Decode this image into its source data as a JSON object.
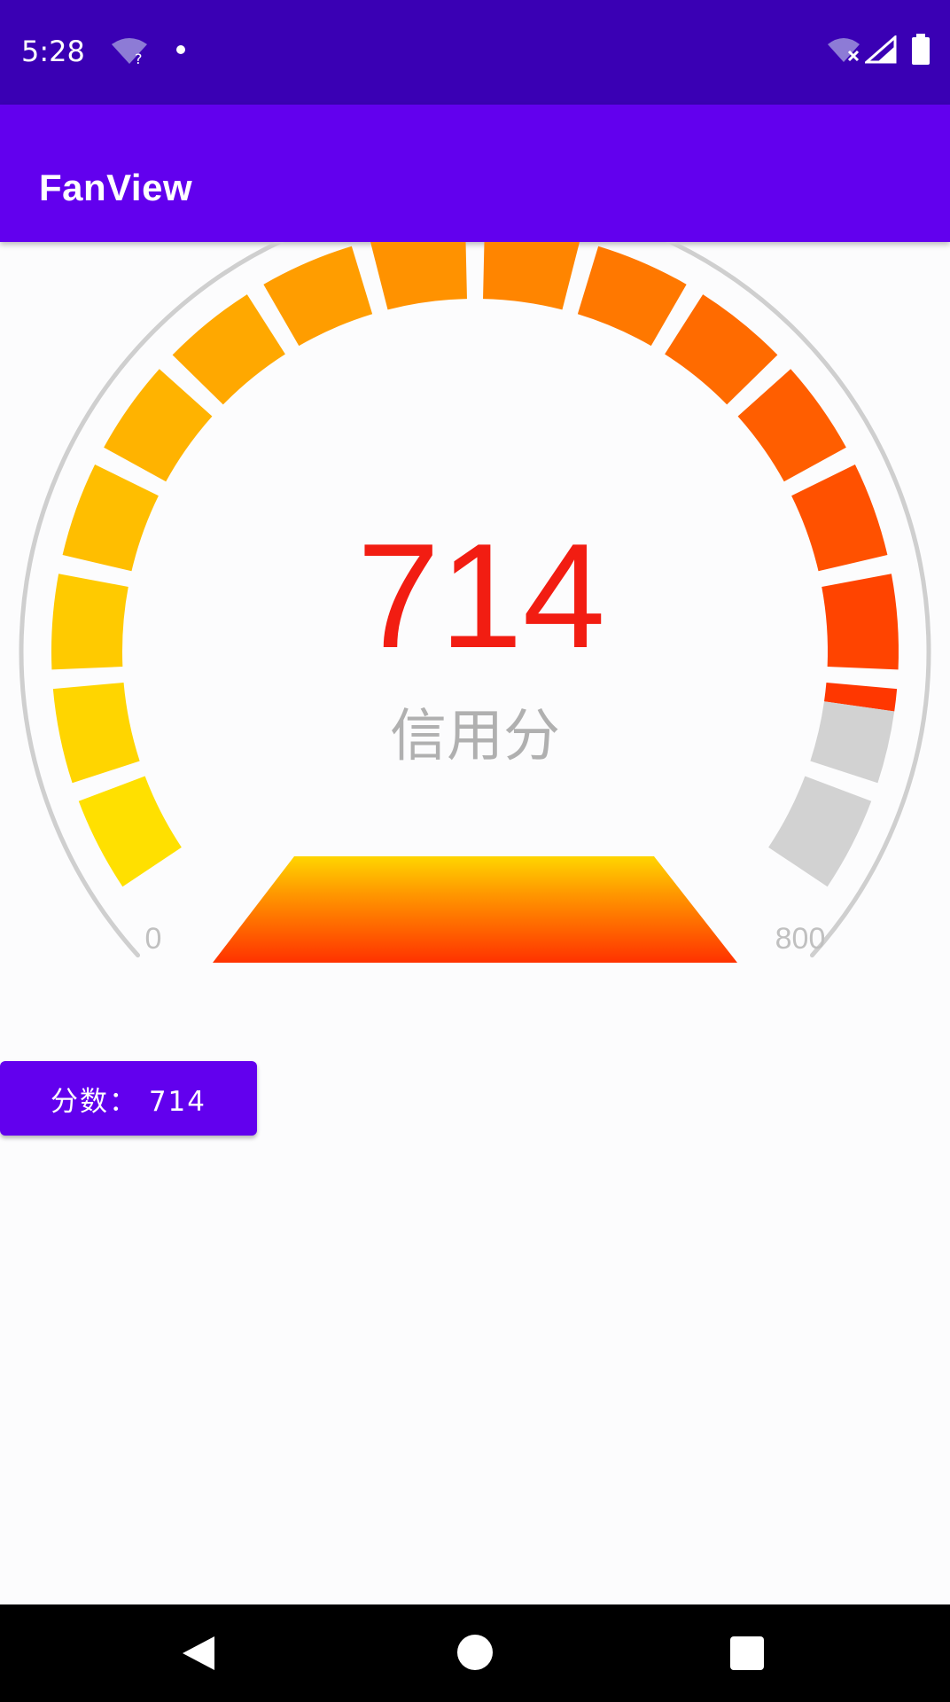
{
  "status_bar": {
    "time": "5:28",
    "wifi_badge": "?",
    "icons": [
      "wifi-question-icon",
      "notification-dot-icon",
      "wifi-off-icon",
      "signal-icon",
      "battery-icon"
    ]
  },
  "app_bar": {
    "title": "FanView"
  },
  "gauge": {
    "score": "714",
    "caption": "信用分",
    "min_label": "0",
    "max_label": "800",
    "value_fraction": 0.8925,
    "segment_count": 16,
    "colors": {
      "score_text": "#f21d12",
      "caption_text": "#b0b0b0",
      "scale_text": "#c0c0c0",
      "outer_arc": "#cfcfcf",
      "inactive_segment": "#d2d2d2",
      "gradient_start": "#ffe000",
      "gradient_mid": "#ff8c00",
      "gradient_end": "#ff2a00"
    }
  },
  "score_button": {
    "label": "分数： 714"
  },
  "nav_bar": {
    "buttons": [
      "back-icon",
      "home-icon",
      "recents-icon"
    ]
  }
}
